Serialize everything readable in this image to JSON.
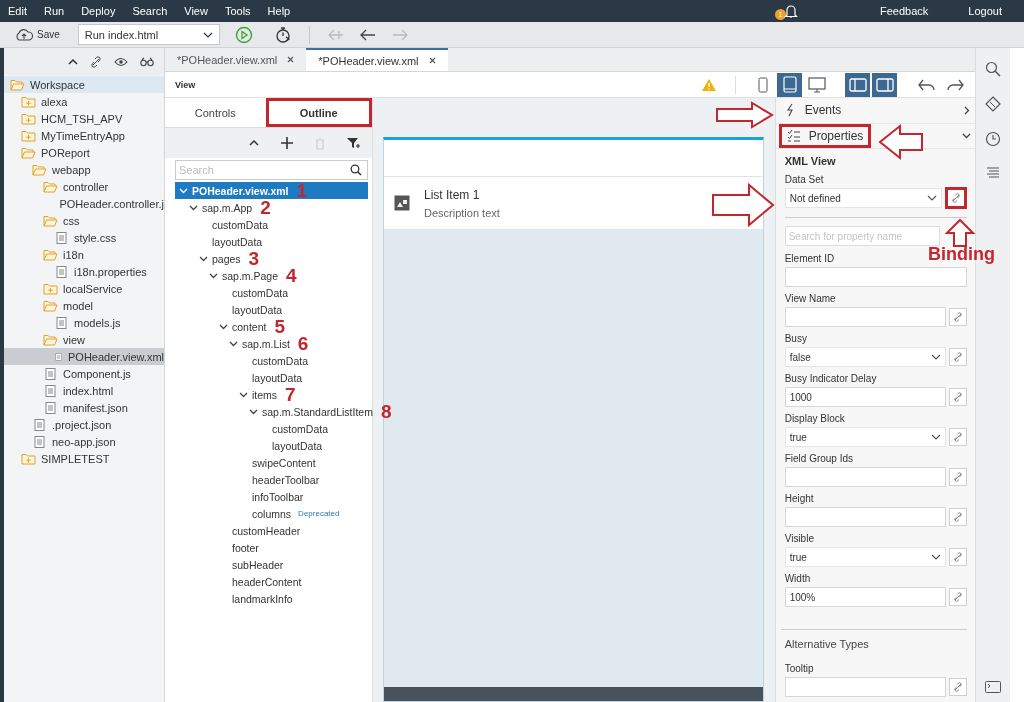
{
  "menu": [
    "Edit",
    "Run",
    "Deploy",
    "Search",
    "View",
    "Tools",
    "Help"
  ],
  "notifications": {
    "count": "1"
  },
  "menu_right": [
    "Feedback",
    "Logout"
  ],
  "toolbar": {
    "save": "Save",
    "run_config": "Run index.html"
  },
  "editor_tabs": [
    {
      "label": "*POHeader.view.xml",
      "selected": false
    },
    {
      "label": "*POHeader.view.xml",
      "selected": true
    }
  ],
  "workspace": [
    {
      "label": "Workspace",
      "kind": "folder",
      "expanded": true,
      "selected": false,
      "children": [
        {
          "label": "alexa",
          "kind": "folder",
          "expanded": false,
          "selected": false
        },
        {
          "label": "HCM_TSH_APV",
          "kind": "folder",
          "expanded": false,
          "selected": false
        },
        {
          "label": "MyTimeEntryApp",
          "kind": "folder",
          "expanded": false,
          "selected": false
        },
        {
          "label": "POReport",
          "kind": "folder",
          "expanded": true,
          "selected": false,
          "children": [
            {
              "label": "webapp",
              "kind": "folder",
              "expanded": true,
              "selected": false,
              "children": [
                {
                  "label": "controller",
                  "kind": "folder",
                  "expanded": true,
                  "selected": false,
                  "children": [
                    {
                      "label": "POHeader.controller.j",
                      "kind": "file",
                      "selected": false
                    }
                  ]
                },
                {
                  "label": "css",
                  "kind": "folder",
                  "expanded": true,
                  "selected": false,
                  "children": [
                    {
                      "label": "style.css",
                      "kind": "file",
                      "selected": false
                    }
                  ]
                },
                {
                  "label": "i18n",
                  "kind": "folder",
                  "expanded": true,
                  "selected": false,
                  "children": [
                    {
                      "label": "i18n.properties",
                      "kind": "file",
                      "selected": false
                    }
                  ]
                },
                {
                  "label": "localService",
                  "kind": "folder",
                  "expanded": false,
                  "selected": false
                },
                {
                  "label": "model",
                  "kind": "folder",
                  "expanded": true,
                  "selected": false,
                  "children": [
                    {
                      "label": "models.js",
                      "kind": "file",
                      "selected": false
                    }
                  ]
                },
                {
                  "label": "view",
                  "kind": "folder",
                  "expanded": true,
                  "selected": false,
                  "children": [
                    {
                      "label": "POHeader.view.xml",
                      "kind": "file",
                      "selected": true
                    }
                  ]
                },
                {
                  "label": "Component.js",
                  "kind": "file",
                  "selected": false
                },
                {
                  "label": "index.html",
                  "kind": "file",
                  "selected": false
                },
                {
                  "label": "manifest.json",
                  "kind": "file",
                  "selected": false
                }
              ]
            },
            {
              "label": ".project.json",
              "kind": "file",
              "selected": false
            },
            {
              "label": "neo-app.json",
              "kind": "file",
              "selected": false
            }
          ]
        },
        {
          "label": "SIMPLETEST",
          "kind": "folder",
          "expanded": false,
          "selected": false
        }
      ]
    }
  ],
  "view_header": {
    "title": "View",
    "devices": [
      {
        "kind": "phone",
        "selected": false
      },
      {
        "kind": "tablet",
        "selected": true
      },
      {
        "kind": "desktop",
        "selected": false
      }
    ],
    "panes": [
      {
        "kind": "left",
        "selected": true
      },
      {
        "kind": "right",
        "selected": true
      }
    ]
  },
  "palette_tabs": [
    {
      "label": "Controls",
      "selected": false,
      "highlighted": false
    },
    {
      "label": "Outline",
      "selected": true,
      "highlighted": true
    }
  ],
  "outline_search": {
    "placeholder": "Search"
  },
  "outline": [
    {
      "label": "POHeader.view.xml",
      "expanded": true,
      "selected": true,
      "annotation": "1",
      "children": [
        {
          "label": "sap.m.App",
          "expanded": true,
          "selected": false,
          "annotation": "2",
          "children": [
            {
              "label": "customData",
              "selected": false
            },
            {
              "label": "layoutData",
              "selected": false
            },
            {
              "label": "pages",
              "expanded": true,
              "selected": false,
              "annotation": "3",
              "children": [
                {
                  "label": "sap.m.Page",
                  "expanded": true,
                  "selected": false,
                  "annotation": "4",
                  "children": [
                    {
                      "label": "customData",
                      "selected": false
                    },
                    {
                      "label": "layoutData",
                      "selected": false
                    },
                    {
                      "label": "content",
                      "expanded": true,
                      "selected": false,
                      "annotation": "5",
                      "children": [
                        {
                          "label": "sap.m.List",
                          "expanded": true,
                          "selected": false,
                          "annotation": "6",
                          "children": [
                            {
                              "label": "customData",
                              "selected": false
                            },
                            {
                              "label": "layoutData",
                              "selected": false
                            },
                            {
                              "label": "items",
                              "expanded": true,
                              "selected": false,
                              "annotation": "7",
                              "children": [
                                {
                                  "label": "sap.m.StandardListItem",
                                  "expanded": true,
                                  "selected": false,
                                  "annotation": "8",
                                  "children": [
                                    {
                                      "label": "customData",
                                      "selected": false
                                    },
                                    {
                                      "label": "layoutData",
                                      "selected": false
                                    }
                                  ]
                                }
                              ]
                            },
                            {
                              "label": "swipeContent",
                              "selected": false
                            },
                            {
                              "label": "headerToolbar",
                              "selected": false
                            },
                            {
                              "label": "infoToolbar",
                              "selected": false
                            },
                            {
                              "label": "columns",
                              "selected": false,
                              "badge": "Deprecated"
                            }
                          ]
                        }
                      ]
                    },
                    {
                      "label": "customHeader",
                      "selected": false
                    },
                    {
                      "label": "footer",
                      "selected": false
                    },
                    {
                      "label": "subHeader",
                      "selected": false
                    },
                    {
                      "label": "headerContent",
                      "selected": false
                    },
                    {
                      "label": "landmarkInfo",
                      "selected": false
                    }
                  ]
                }
              ]
            }
          ]
        }
      ]
    }
  ],
  "preview": {
    "list_items": [
      {
        "title": "List Item 1",
        "description": "Description text"
      }
    ]
  },
  "panels": [
    {
      "label": "Events",
      "kind": "events",
      "expanded": false,
      "highlighted": false
    },
    {
      "label": "Properties",
      "kind": "properties",
      "expanded": true,
      "highlighted": true
    }
  ],
  "properties": {
    "title": "XML View",
    "data_set": {
      "label": "Data Set",
      "value": "Not defined",
      "binding_highlighted": true
    },
    "search": {
      "placeholder": "Search for property name"
    },
    "fields": [
      {
        "label": "Element ID",
        "kind": "input",
        "binding": false
      },
      {
        "label": "View Name",
        "kind": "input",
        "binding": true
      },
      {
        "label": "Busy",
        "kind": "select",
        "value": "false",
        "binding": true
      },
      {
        "label": "Busy Indicator Delay",
        "kind": "input",
        "value": "1000",
        "binding": true
      },
      {
        "label": "Display Block",
        "kind": "select",
        "value": "true",
        "binding": true
      },
      {
        "label": "Field Group Ids",
        "kind": "input",
        "binding": true
      },
      {
        "label": "Height",
        "kind": "input",
        "binding": true
      },
      {
        "label": "Visible",
        "kind": "select",
        "value": "true",
        "binding": true
      },
      {
        "label": "Width",
        "kind": "input",
        "value": "100%",
        "binding": true
      }
    ],
    "section": "Alternative Types",
    "section_fields": [
      {
        "label": "Tooltip",
        "kind": "input",
        "binding": true
      }
    ]
  },
  "annotations": {
    "binding_label": "Binding"
  }
}
